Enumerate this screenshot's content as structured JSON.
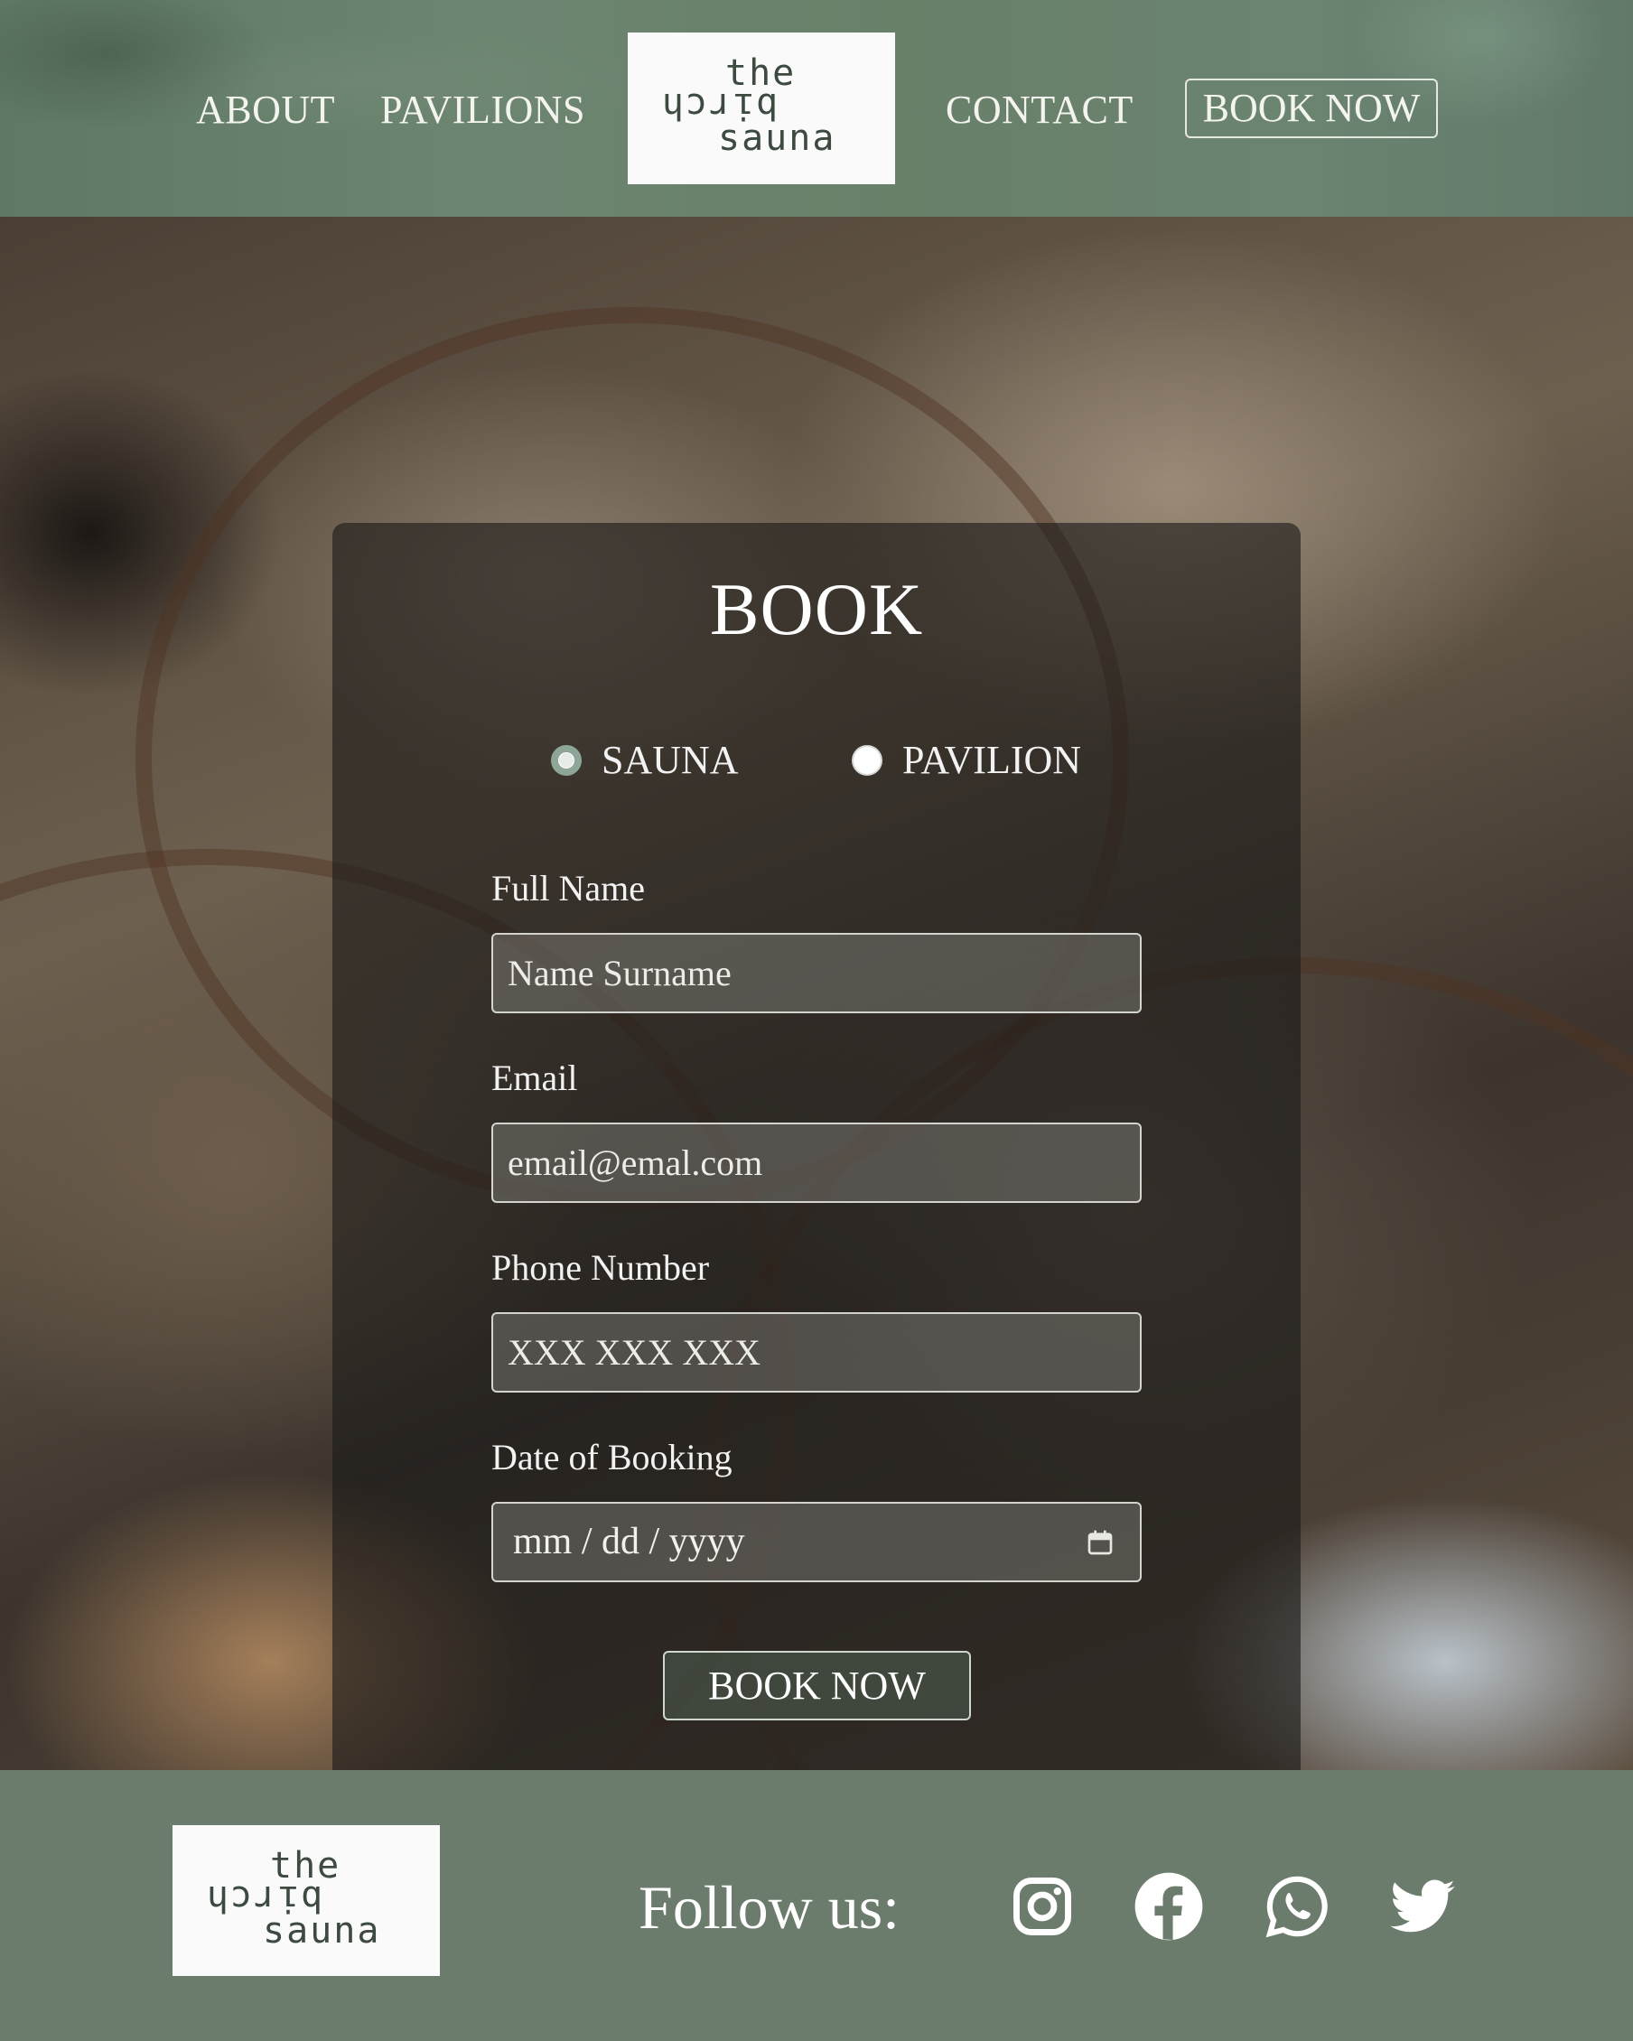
{
  "header": {
    "nav": {
      "about": "ABOUT",
      "pavilions": "PAVILIONS",
      "contact": "CONTACT",
      "book_now": "BOOK NOW"
    },
    "logo": {
      "line1": "the",
      "line2": "birch",
      "line3": "sauna"
    }
  },
  "form": {
    "title": "BOOK",
    "options": [
      {
        "label": "SAUNA",
        "selected": true
      },
      {
        "label": "PAVILION",
        "selected": false
      }
    ],
    "fields": {
      "name": {
        "label": "Full Name",
        "placeholder": "Name Surname"
      },
      "email": {
        "label": "Email",
        "placeholder": "email@emal.com"
      },
      "phone": {
        "label": "Phone Number",
        "placeholder": "XXX XXX XXX"
      },
      "date": {
        "label": "Date of Booking",
        "placeholder": "mm / dd / yyyy"
      }
    },
    "submit": "BOOK NOW"
  },
  "footer": {
    "logo": {
      "line1": "the",
      "line2": "birch",
      "line3": "sauna"
    },
    "follow": "Follow us:",
    "social_icons": [
      "instagram-icon",
      "facebook-icon",
      "whatsapp-icon",
      "twitter-icon"
    ]
  },
  "colors": {
    "header_green": "#6a8470",
    "footer_green": "#6b7b6c",
    "accent_radio": "#8ea697",
    "text_light": "#f2f2f2"
  }
}
